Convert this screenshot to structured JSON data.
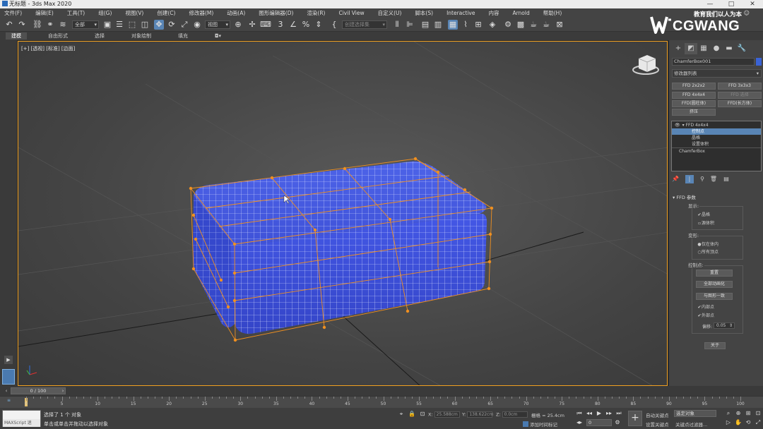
{
  "window": {
    "title": "无标题 - 3ds Max 2020",
    "controls": [
      "—",
      "□",
      "✕"
    ]
  },
  "menu": {
    "items": [
      "文件(F)",
      "编辑(E)",
      "工具(T)",
      "组(G)",
      "视图(V)",
      "创建(C)",
      "修改器(M)",
      "动画(A)",
      "图形编辑器(D)",
      "渲染(R)",
      "Civil View",
      "自定义(U)",
      "脚本(S)",
      "Interactive",
      "内容",
      "Arnold",
      "帮助(H)"
    ]
  },
  "toolbar": {
    "selection_filter": "全部",
    "view_dropdown": "视图",
    "named_selection_placeholder": "创建选择集"
  },
  "ribbon": {
    "tabs": [
      "建模",
      "自由形式",
      "选择",
      "对象绘制",
      "填充"
    ]
  },
  "viewport": {
    "label": "[+] [透视] [标准] [边面]"
  },
  "command_panel": {
    "object_name": "ChamferBox001",
    "object_color": "#3a63d6",
    "modifier_list": "修改器列表",
    "buttons": {
      "ffd222": "FFD 2x2x2",
      "ffd333": "FFD 3x3x3",
      "ffd444": "FFD 4x4x4",
      "ffd_select": "FFD 选择",
      "ffd_cyl": "FFD(圆柱体)",
      "ffd_box": "FFD(长方体)",
      "squeeze": "挤压"
    },
    "stack": {
      "modifier": "FFD 4x4x4",
      "sub_items": [
        "控制点",
        "晶格",
        "设置体积"
      ],
      "base_object": "ChamferBox"
    },
    "params": {
      "rollout_title": "FFD 参数",
      "display_label": "显示:",
      "lattice_label": "晶格",
      "source_volume_label": "源体积",
      "deform_label": "变形:",
      "only_in_volume": "仅在体内",
      "all_vertices": "所有顶点",
      "control_points_label": "控制点:",
      "reset": "重置",
      "animate_all": "全部动画化",
      "conform_to_shape": "与图形一致",
      "inside_points": "内部点",
      "outside_points": "外部点",
      "offset_label": "偏移:",
      "offset_value": "0.05",
      "about": "关于"
    }
  },
  "timeline": {
    "frame_display": "0 / 100",
    "ticks": [
      "0",
      "5",
      "10",
      "15",
      "20",
      "25",
      "30",
      "35",
      "40",
      "45",
      "50",
      "55",
      "60",
      "65",
      "70",
      "75",
      "80",
      "85",
      "90",
      "95",
      "100"
    ]
  },
  "status": {
    "maxscript_label": "MAXScript 迷",
    "selection_info": "选择了 1 个 对象",
    "prompt": "单击或单击并拖动以选择对象",
    "x_label": "X:",
    "x_value": "25.588cm",
    "y_label": "Y:",
    "y_value": "138.622cm",
    "z_label": "Z:",
    "z_value": "0.0cm",
    "grid": "栅格 = 25.4cm",
    "add_time_tag": "添加时间标记",
    "auto_key": "自动关键点",
    "set_key": "设置关键点",
    "selected_object": "选定对象",
    "key_filters": "关键点过滤器...",
    "current_frame": "0"
  },
  "watermark": {
    "subtitle": "教育我们以人为本",
    "brand": "CGWANG"
  }
}
